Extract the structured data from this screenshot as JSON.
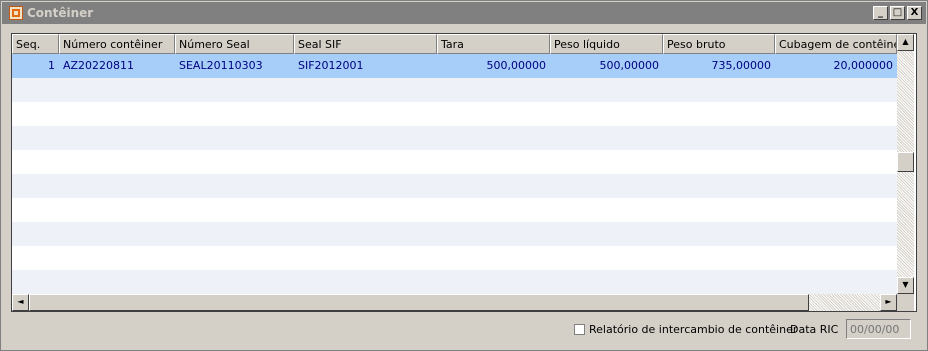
{
  "window": {
    "title": "Contêiner",
    "icon": "app-icon"
  },
  "title_buttons": {
    "minimize": "_",
    "maximize": "□",
    "close": "X"
  },
  "table": {
    "columns": [
      "Seq.",
      "Número contêiner",
      "Número Seal",
      "Seal SIF",
      "Tara",
      "Peso líquido",
      "Peso bruto",
      "Cubagem de contêineres"
    ],
    "rows": [
      {
        "seq": "1",
        "numero_conteiner": "AZ20220811",
        "numero_seal": "SEAL20110303",
        "seal_sif": "SIF2012001",
        "tara": "500,00000",
        "peso_liquido": "500,00000",
        "peso_bruto": "735,00000",
        "cubagem": "20,000000"
      }
    ]
  },
  "footer": {
    "checkbox_label": "Relatório de intercambio de contêiner",
    "date_label": "Data RIC",
    "date_placeholder": "00/00/00"
  }
}
